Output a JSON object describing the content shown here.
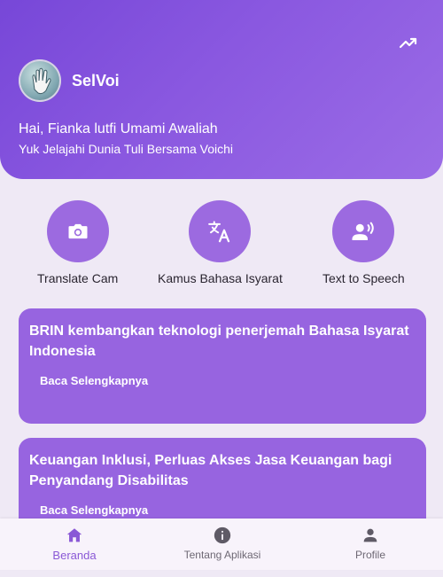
{
  "header": {
    "app_name": "SelVoi",
    "greeting": "Hai, Fianka lutfi Umami Awaliah",
    "subtitle": "Yuk Jelajahi Dunia Tuli Bersama Voichi"
  },
  "features": [
    {
      "label": "Translate Cam",
      "icon": "camera-icon"
    },
    {
      "label": "Kamus Bahasa Isyarat",
      "icon": "translate-icon"
    },
    {
      "label": "Text to Speech",
      "icon": "voice-icon"
    }
  ],
  "news": [
    {
      "title": "BRIN kembangkan teknologi penerjemah Bahasa Isyarat Indonesia",
      "link": "Baca Selengkapnya"
    },
    {
      "title": "Keuangan Inklusi, Perluas Akses Jasa Keuangan bagi Penyandang Disabilitas",
      "link": "Baca Selengkapnya"
    }
  ],
  "bottom_nav": [
    {
      "label": "Beranda",
      "icon": "home-icon",
      "active": true
    },
    {
      "label": "Tentang Aplikasi",
      "icon": "info-icon",
      "active": false
    },
    {
      "label": "Profile",
      "icon": "person-icon",
      "active": false
    }
  ],
  "colors": {
    "primary": "#8a58e0",
    "card": "#9764e0",
    "background": "#efe9f5",
    "nav_active": "#8a58d6"
  }
}
